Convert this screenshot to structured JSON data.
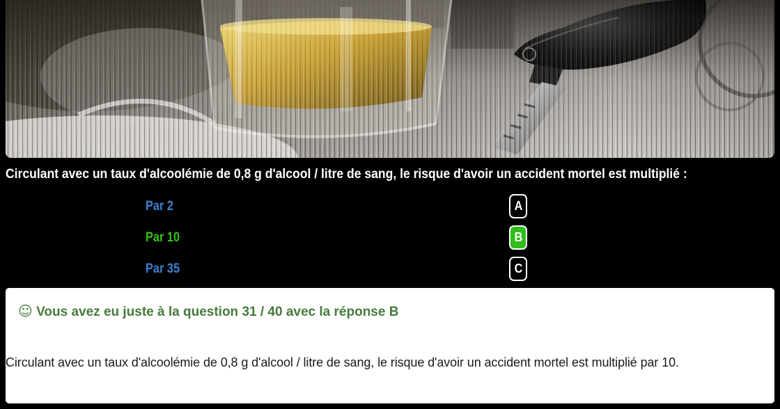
{
  "question": {
    "text": "Circulant avec un taux d'alcoolémie de 0,8 g d'alcool / litre de sang, le risque d'avoir un accident mortel est multiplié :"
  },
  "answers": [
    {
      "letter": "A",
      "label": "Par 2",
      "is_correct": false
    },
    {
      "letter": "B",
      "label": "Par 10",
      "is_correct": true
    },
    {
      "letter": "C",
      "label": "Par 35",
      "is_correct": false
    }
  ],
  "result": {
    "icon": "smiley-icon",
    "icon_glyph": "☺",
    "heading": {
      "prefix": "Vous avez eu juste à la question",
      "current": 31,
      "separator": "/",
      "total": 40,
      "suffix": "avec la réponse",
      "answer": "B"
    },
    "explanation": "Circulant avec un taux d'alcoolémie de 0,8 g d'alcool / litre de sang, le risque d'avoir un accident mortel est multiplié par 10."
  },
  "colors": {
    "page_background": "#000000",
    "question_text": "#ffffff",
    "answer_default": "#3a83d2",
    "answer_correct": "#36c212",
    "badge_default_bg": "#000000",
    "badge_correct_bg": "#2fbd1b",
    "badge_border": "#ffffff",
    "result_heading": "#467b3a",
    "result_panel_bg": "#ffffff",
    "result_text": "#1a1a1a"
  }
}
